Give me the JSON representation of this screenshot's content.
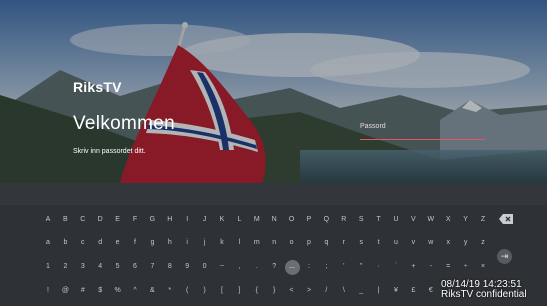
{
  "brand": "RiksTV",
  "welcome_title": "Velkommen",
  "welcome_subtitle": "Skriv inn passordet ditt.",
  "password": {
    "label": "Passord"
  },
  "keyboard": {
    "row1": [
      "A",
      "B",
      "C",
      "D",
      "E",
      "F",
      "G",
      "H",
      "I",
      "J",
      "K",
      "L",
      "M",
      "N",
      "O",
      "P",
      "Q",
      "R",
      "S",
      "T",
      "U",
      "V",
      "W",
      "X",
      "Y",
      "Z"
    ],
    "row2": [
      "a",
      "b",
      "c",
      "d",
      "e",
      "f",
      "g",
      "h",
      "i",
      "j",
      "k",
      "l",
      "m",
      "n",
      "o",
      "p",
      "q",
      "r",
      "s",
      "t",
      "u",
      "v",
      "w",
      "x",
      "y",
      "z"
    ],
    "row3": [
      "1",
      "2",
      "3",
      "4",
      "5",
      "6",
      "7",
      "8",
      "9",
      "0",
      "~",
      ",",
      ".",
      "?",
      "...",
      ":",
      ";",
      "'",
      "\"",
      "·",
      "`",
      "+",
      "-",
      "=",
      "÷",
      "×"
    ],
    "row4": [
      "!",
      "@",
      "#",
      "$",
      "%",
      "^",
      "&",
      "*",
      "(",
      ")",
      "[",
      "]",
      "{",
      "}",
      "<",
      ">",
      "/",
      "\\",
      "_",
      "|",
      "¥",
      "£",
      "€"
    ],
    "selected_key": "...",
    "backspace_icon": "backspace-icon",
    "enter_icon": "enter-icon",
    "enter_glyph": "⇥"
  },
  "overlay": {
    "timestamp": "08/14/19 14:23:51",
    "watermark": "RiksTV confidential"
  },
  "colors": {
    "accent": "#e25466",
    "keyboard_bg": "#2e3136",
    "key_text": "#c3c6cb"
  }
}
